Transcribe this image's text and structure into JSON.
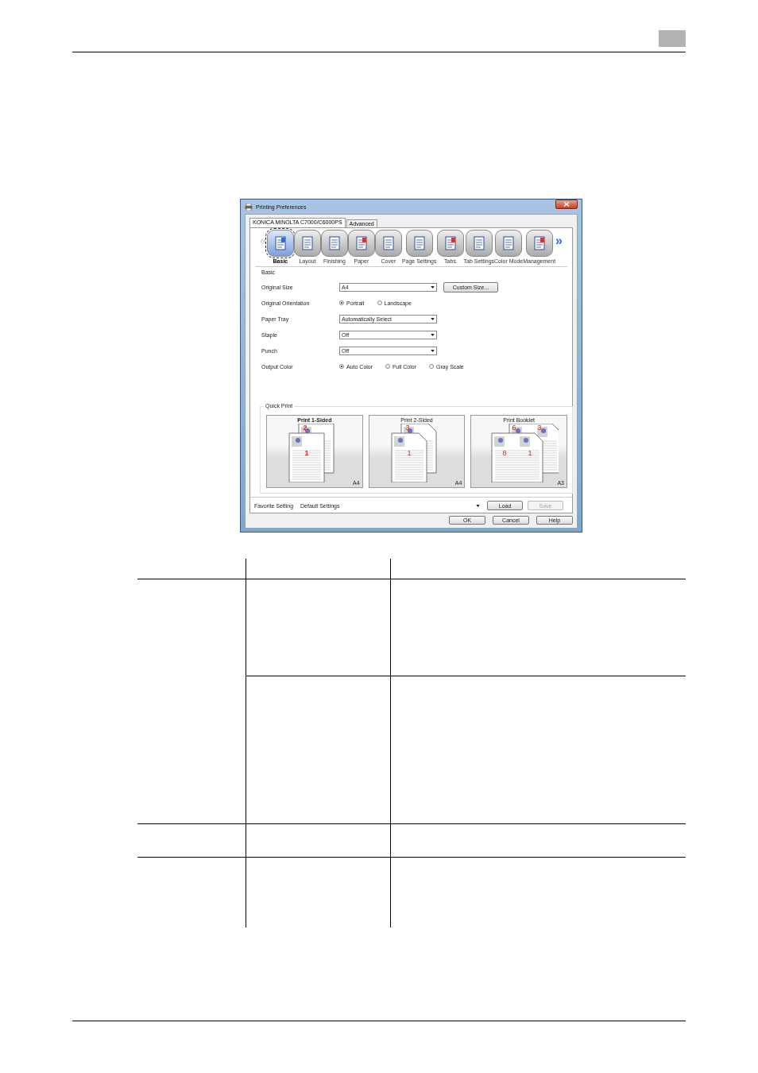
{
  "window": {
    "title": "Printing Preferences"
  },
  "tabs": [
    {
      "label": "KONICA MINOLTA C7000/C6000PS",
      "selected": true
    },
    {
      "label": "Advanced",
      "selected": false
    }
  ],
  "toolbar": {
    "prev": "«",
    "next": "»",
    "items": [
      {
        "label": "Basic",
        "selected": true
      },
      {
        "label": "Layout",
        "selected": false
      },
      {
        "label": "Finishing",
        "selected": false
      },
      {
        "label": "Paper",
        "selected": false
      },
      {
        "label": "Cover",
        "selected": false
      },
      {
        "label": "Page Settings",
        "selected": false
      },
      {
        "label": "Tabs",
        "selected": false
      },
      {
        "label": "Tab Settings",
        "selected": false
      },
      {
        "label": "Color Mode",
        "selected": false
      },
      {
        "label": "Management",
        "selected": false
      }
    ]
  },
  "section_title": "Basic",
  "settings": [
    {
      "label": "Original Size",
      "kind": "select",
      "value": "A4",
      "button": "Custom Size..."
    },
    {
      "label": "Original Orientation",
      "kind": "radio",
      "options": [
        {
          "label": "Portrait",
          "selected": true
        },
        {
          "label": "Landscape",
          "selected": false
        }
      ]
    },
    {
      "label": "Paper Tray",
      "kind": "select",
      "value": "Automatically Select"
    },
    {
      "label": "Staple",
      "kind": "select",
      "value": "Off"
    },
    {
      "label": "Punch",
      "kind": "select",
      "value": "Off"
    },
    {
      "label": "Output Color",
      "kind": "radio",
      "options": [
        {
          "label": "Auto Color",
          "selected": true
        },
        {
          "label": "Full Color",
          "selected": false
        },
        {
          "label": "Gray Scale",
          "selected": false
        }
      ]
    }
  ],
  "quick_print": {
    "title": "Quick Print",
    "cards": [
      {
        "title": "Print 1-Sided",
        "selected": true,
        "kind": "single",
        "paper": "A4",
        "back_pages": [
          "2"
        ],
        "front_pages": [
          "1"
        ]
      },
      {
        "title": "Print 2-Sided",
        "selected": false,
        "kind": "duplex",
        "paper": "A4",
        "back_pages": [
          "3"
        ],
        "front_pages": [
          "1"
        ]
      },
      {
        "title": "Print Booklet",
        "selected": false,
        "kind": "booklet",
        "paper": "A3",
        "back_pages": [
          "6",
          "3"
        ],
        "front_pages": [
          "8",
          "1"
        ]
      }
    ]
  },
  "favorite": {
    "label": "Favorite Setting",
    "value": "Default Settings",
    "buttons": [
      {
        "label": "Load",
        "disabled": false
      },
      {
        "label": "Save",
        "disabled": true
      }
    ]
  },
  "buttons": [
    "OK",
    "Cancel",
    "Help"
  ]
}
